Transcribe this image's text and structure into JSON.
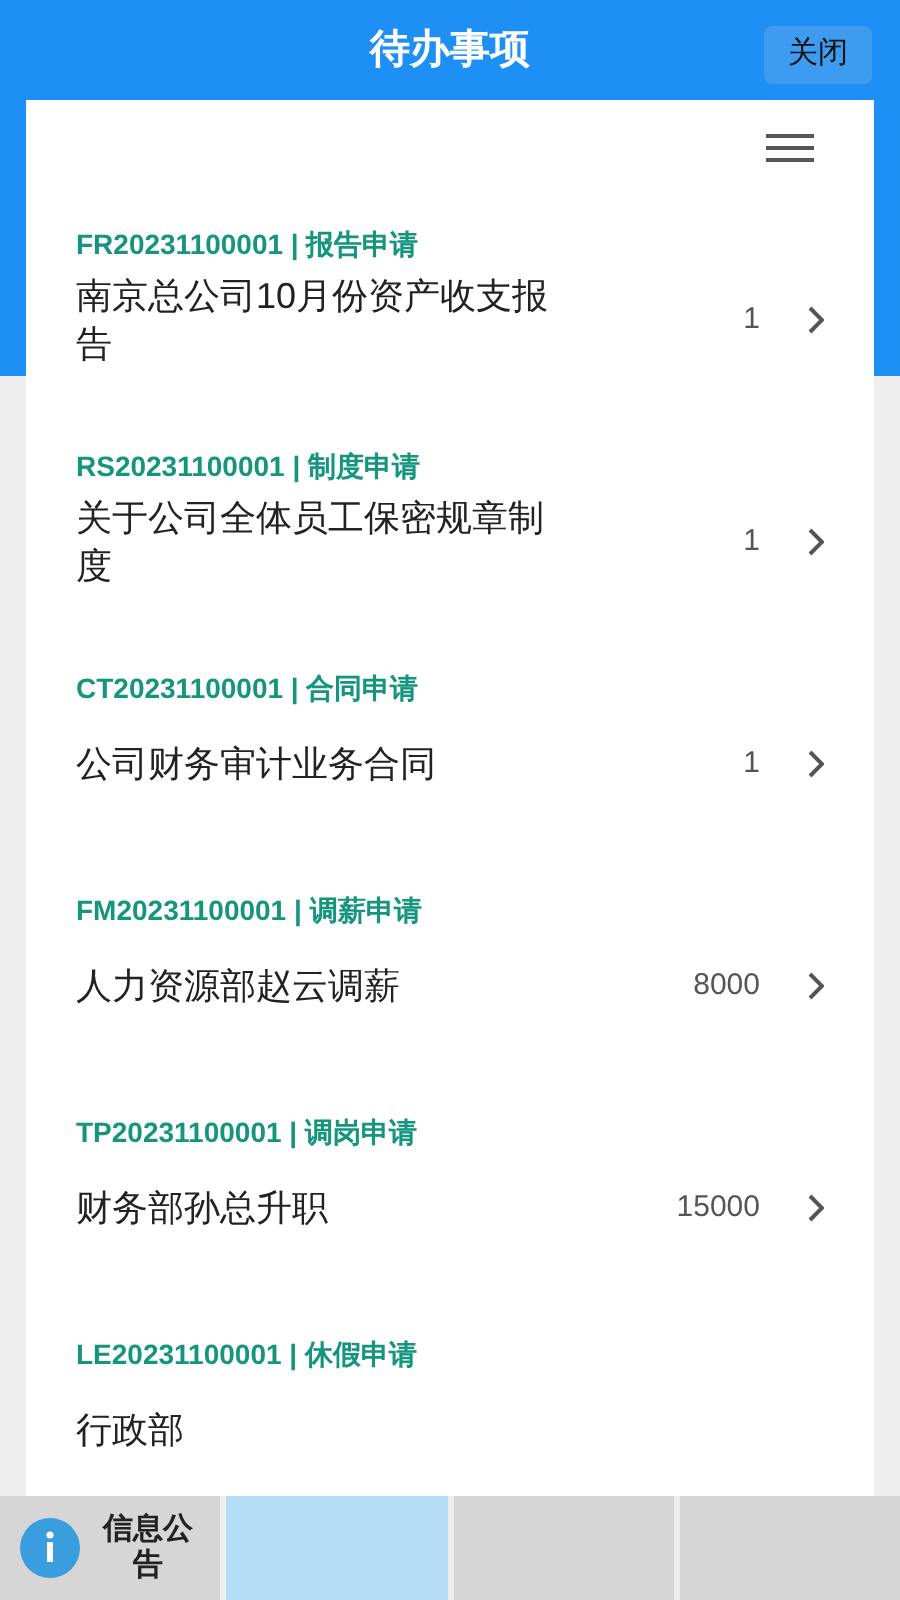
{
  "header": {
    "title": "待办事项",
    "close_button": "关闭"
  },
  "tasks": [
    {
      "code": "FR20231100001 | 报告申请",
      "title": "南京总公司10月份资产收支报告",
      "value": "1"
    },
    {
      "code": "RS20231100001 | 制度申请",
      "title": "关于公司全体员工保密规章制度",
      "value": "1"
    },
    {
      "code": "CT20231100001 | 合同申请",
      "title": "公司财务审计业务合同",
      "value": "1"
    },
    {
      "code": "FM20231100001 | 调薪申请",
      "title": "人力资源部赵云调薪",
      "value": "8000"
    },
    {
      "code": "TP20231100001 | 调岗申请",
      "title": "财务部孙总升职",
      "value": "15000"
    },
    {
      "code": "LE20231100001 | 休假申请",
      "title": "行政部"
    }
  ],
  "bottom_tabs": [
    {
      "label": "信息公告",
      "selected": false
    },
    {
      "selected": true
    },
    {
      "selected": false
    },
    {
      "selected": false
    }
  ]
}
